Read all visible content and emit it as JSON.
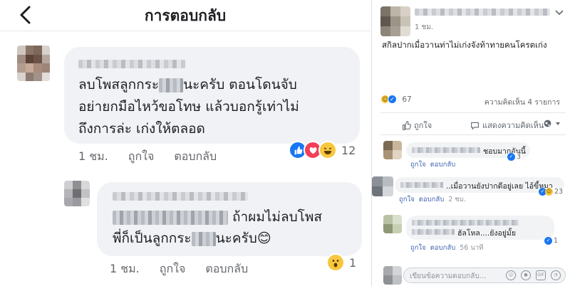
{
  "left": {
    "title": "การตอบกลับ",
    "comment1": {
      "line1_prefix": "ลบโพสลูกกระ",
      "line1_suffix": "นะครับ ตอนโดนจับ",
      "line2": "อย่ายกมือไหว้ขอโทษ แล้วบอกรู้เท่าไม่",
      "line3": "ถึงการล่ะ เก่งให้ตลอด",
      "time": "1 ชม.",
      "like": "ถูกใจ",
      "reply": "ตอบกลับ",
      "reaction_count": "12"
    },
    "comment2": {
      "line2_suffix": "ถ้าผมไม่ลบโพส",
      "line3_prefix": "พี่ก็เป็นลูกกระ",
      "line3_suffix": "นะครับ",
      "emoji": "😊",
      "time": "1 ชม.",
      "like": "ถูกใจ",
      "reply": "ตอบกลับ",
      "reaction_count": "1"
    }
  },
  "right": {
    "post": {
      "time": "1 ชม.",
      "text": "สกิลปากเมื่อวานท่าไม่เก่งจังท้าทายคนโครตเก่ง",
      "reaction_count": "67",
      "comment_count": "ความคิดเห็น 4 รายการ"
    },
    "actions": {
      "like": "ถูกใจ",
      "comment": "แสดงความคิดเห็น"
    },
    "comments": [
      {
        "text": "ชอบมากอันนี้",
        "like": "ถูกใจ",
        "reply": "ตอบกลับ",
        "time": "",
        "reactions": "3"
      },
      {
        "text": "..เมื่อวานยังปากดีอยู่เลย ไอ้ขี้หมา",
        "like": "ถูกใจ",
        "reply": "ตอบกลับ",
        "time": "2 ชม.",
        "reactions": "23"
      },
      {
        "text": "ฮัลโหล....ยังอยู่มั้ย",
        "like": "ถูกใจ",
        "reply": "ตอบกลับ",
        "time": "56 นาที",
        "reactions": "1"
      }
    ],
    "input_placeholder": "เขียนข้อความตอบกลับ..."
  },
  "colors": {
    "bubble": "#f0f2f5",
    "like_blue": "#1877f2",
    "love_red": "#f33e58",
    "haha_yellow": "#f7c83e",
    "meta_gray": "#65676b",
    "link_blue": "#4267b2"
  },
  "icons": [
    "back-arrow-icon",
    "like-reaction-icon",
    "love-reaction-icon",
    "haha-reaction-icon",
    "wow-reaction-icon",
    "chevron-down-icon",
    "thumbs-up-icon",
    "comment-bubble-icon",
    "emoji-icon",
    "camera-icon",
    "gif-icon",
    "sticker-icon"
  ]
}
